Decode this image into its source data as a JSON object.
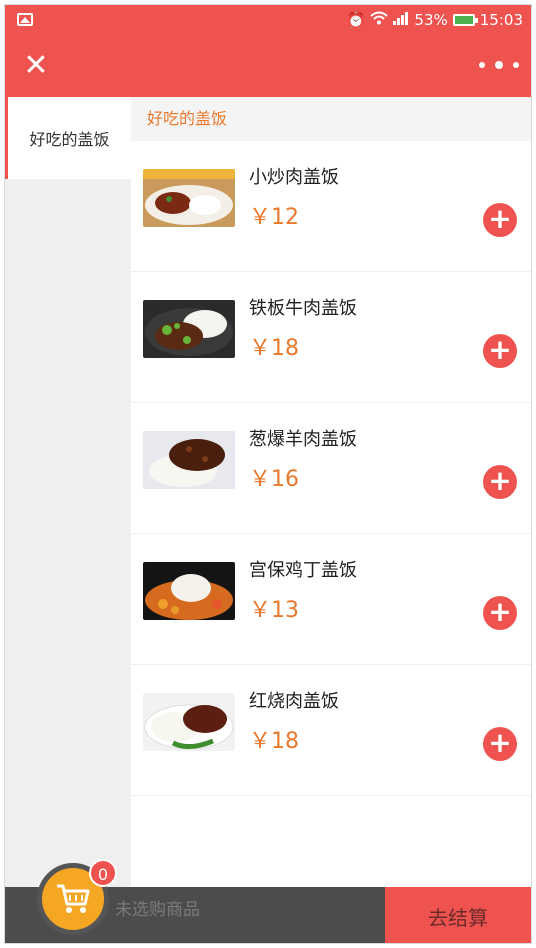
{
  "status_bar": {
    "battery": "53%",
    "time": "15:03"
  },
  "sidebar": {
    "items": [
      {
        "label": "好吃的盖饭"
      }
    ]
  },
  "main": {
    "category": "好吃的盖饭",
    "items": [
      {
        "name": "小炒肉盖饭",
        "price": "￥12"
      },
      {
        "name": "铁板牛肉盖饭",
        "price": "￥18"
      },
      {
        "name": "葱爆羊肉盖饭",
        "price": "￥16"
      },
      {
        "name": "宫保鸡丁盖饭",
        "price": "￥13"
      },
      {
        "name": "红烧肉盖饭",
        "price": "￥18"
      }
    ]
  },
  "cart": {
    "count": "0",
    "empty_text": "未选购商品",
    "checkout_label": "去结算"
  },
  "icons": {
    "close": "close-icon",
    "more": "more-icon",
    "add": "add-icon",
    "cart": "cart-icon"
  },
  "colors": {
    "brand": "#ef5350",
    "price": "#e8792d",
    "cart": "#f5a623",
    "bottombar": "#4c4c4c"
  }
}
